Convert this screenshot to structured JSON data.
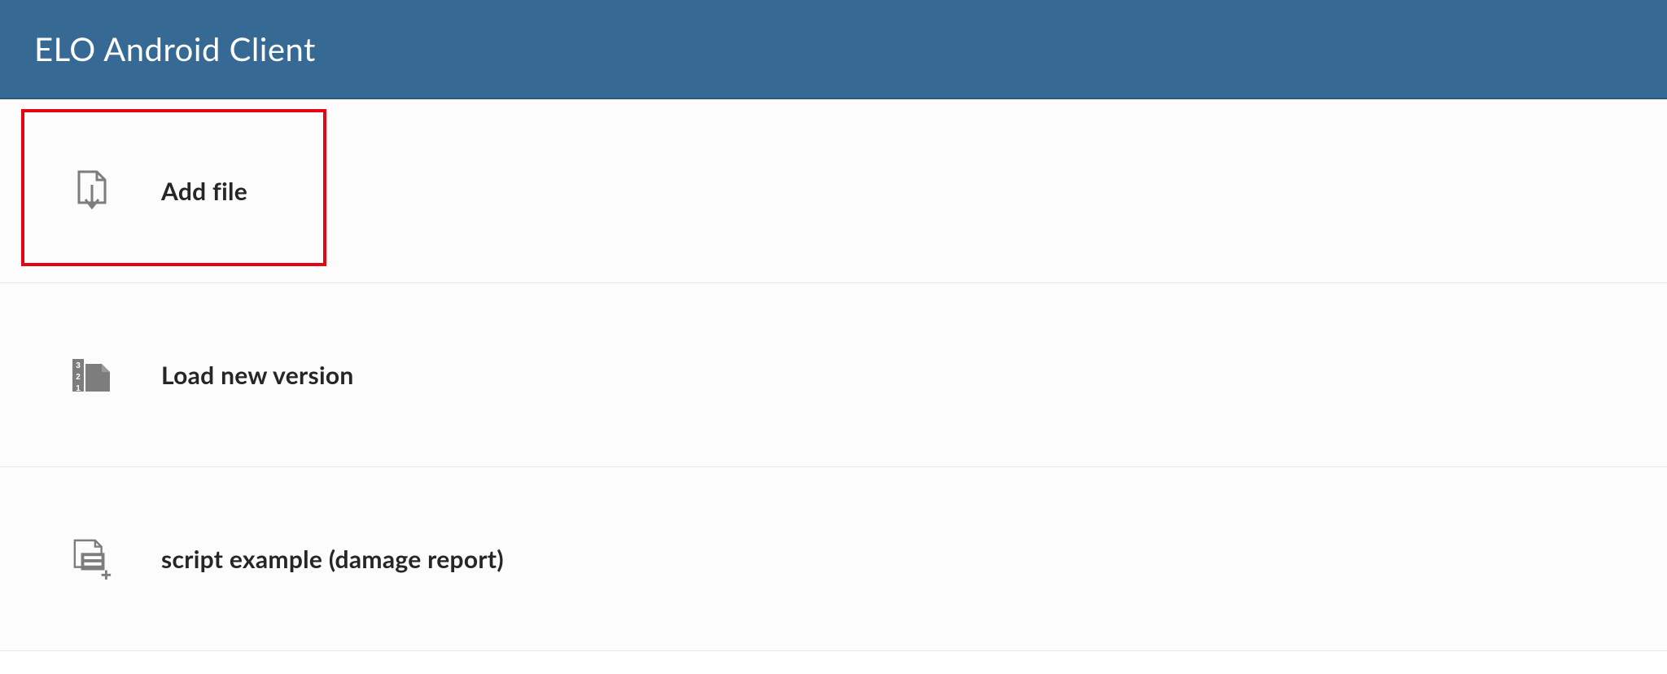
{
  "header": {
    "title": "ELO Android Client"
  },
  "items": [
    {
      "label": "Add file"
    },
    {
      "label": "Load new version"
    },
    {
      "label": "script  example (damage report)"
    }
  ],
  "colors": {
    "header_bg": "#366a94",
    "highlight": "#e30613",
    "text": "#262626",
    "icon": "#7d7d7d"
  }
}
